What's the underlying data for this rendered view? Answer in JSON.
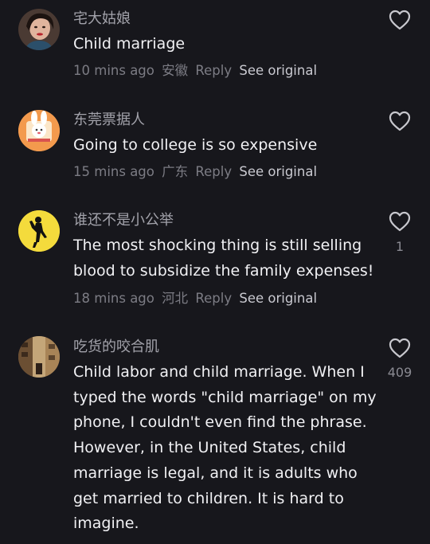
{
  "comments": [
    {
      "username": "宅大姑娘",
      "lines": [
        "Child marriage"
      ],
      "time": "10 mins ago",
      "location": "安徽",
      "reply_label": "Reply",
      "see_original_label": "See original",
      "likes": "",
      "avatar_icon": "woman-portrait-avatar"
    },
    {
      "username": "东莞票据人",
      "lines": [
        "Going to college is so expensive"
      ],
      "time": "15 mins ago",
      "location": "广东",
      "reply_label": "Reply",
      "see_original_label": "See original",
      "likes": "",
      "avatar_icon": "cartoon-rabbit-avatar"
    },
    {
      "username": "谁还不是小公举",
      "lines": [
        "The most shocking thing is still selling",
        "blood to subsidize the family expenses!"
      ],
      "time": "18 mins ago",
      "location": "河北",
      "reply_label": "Reply",
      "see_original_label": "See original",
      "likes": "1",
      "avatar_icon": "dancer-silhouette-avatar"
    },
    {
      "username": "吃货的咬合肌",
      "lines": [
        "Child labor and child marriage. When I",
        "typed the words \"child marriage\" on my",
        "phone, I couldn't even find the phrase.",
        "However, in the United States, child",
        "marriage is legal, and it is adults who",
        "get married to children. It is hard to",
        "imagine."
      ],
      "time": "",
      "location": "",
      "reply_label": "",
      "see_original_label": "",
      "likes": "409",
      "avatar_icon": "street-photo-avatar"
    }
  ],
  "colors": {
    "background": "#17171c",
    "text": "#f1f1f4",
    "username": "#a2a2aa",
    "meta": "#7c7c84",
    "see_original": "#c9c9d0"
  }
}
